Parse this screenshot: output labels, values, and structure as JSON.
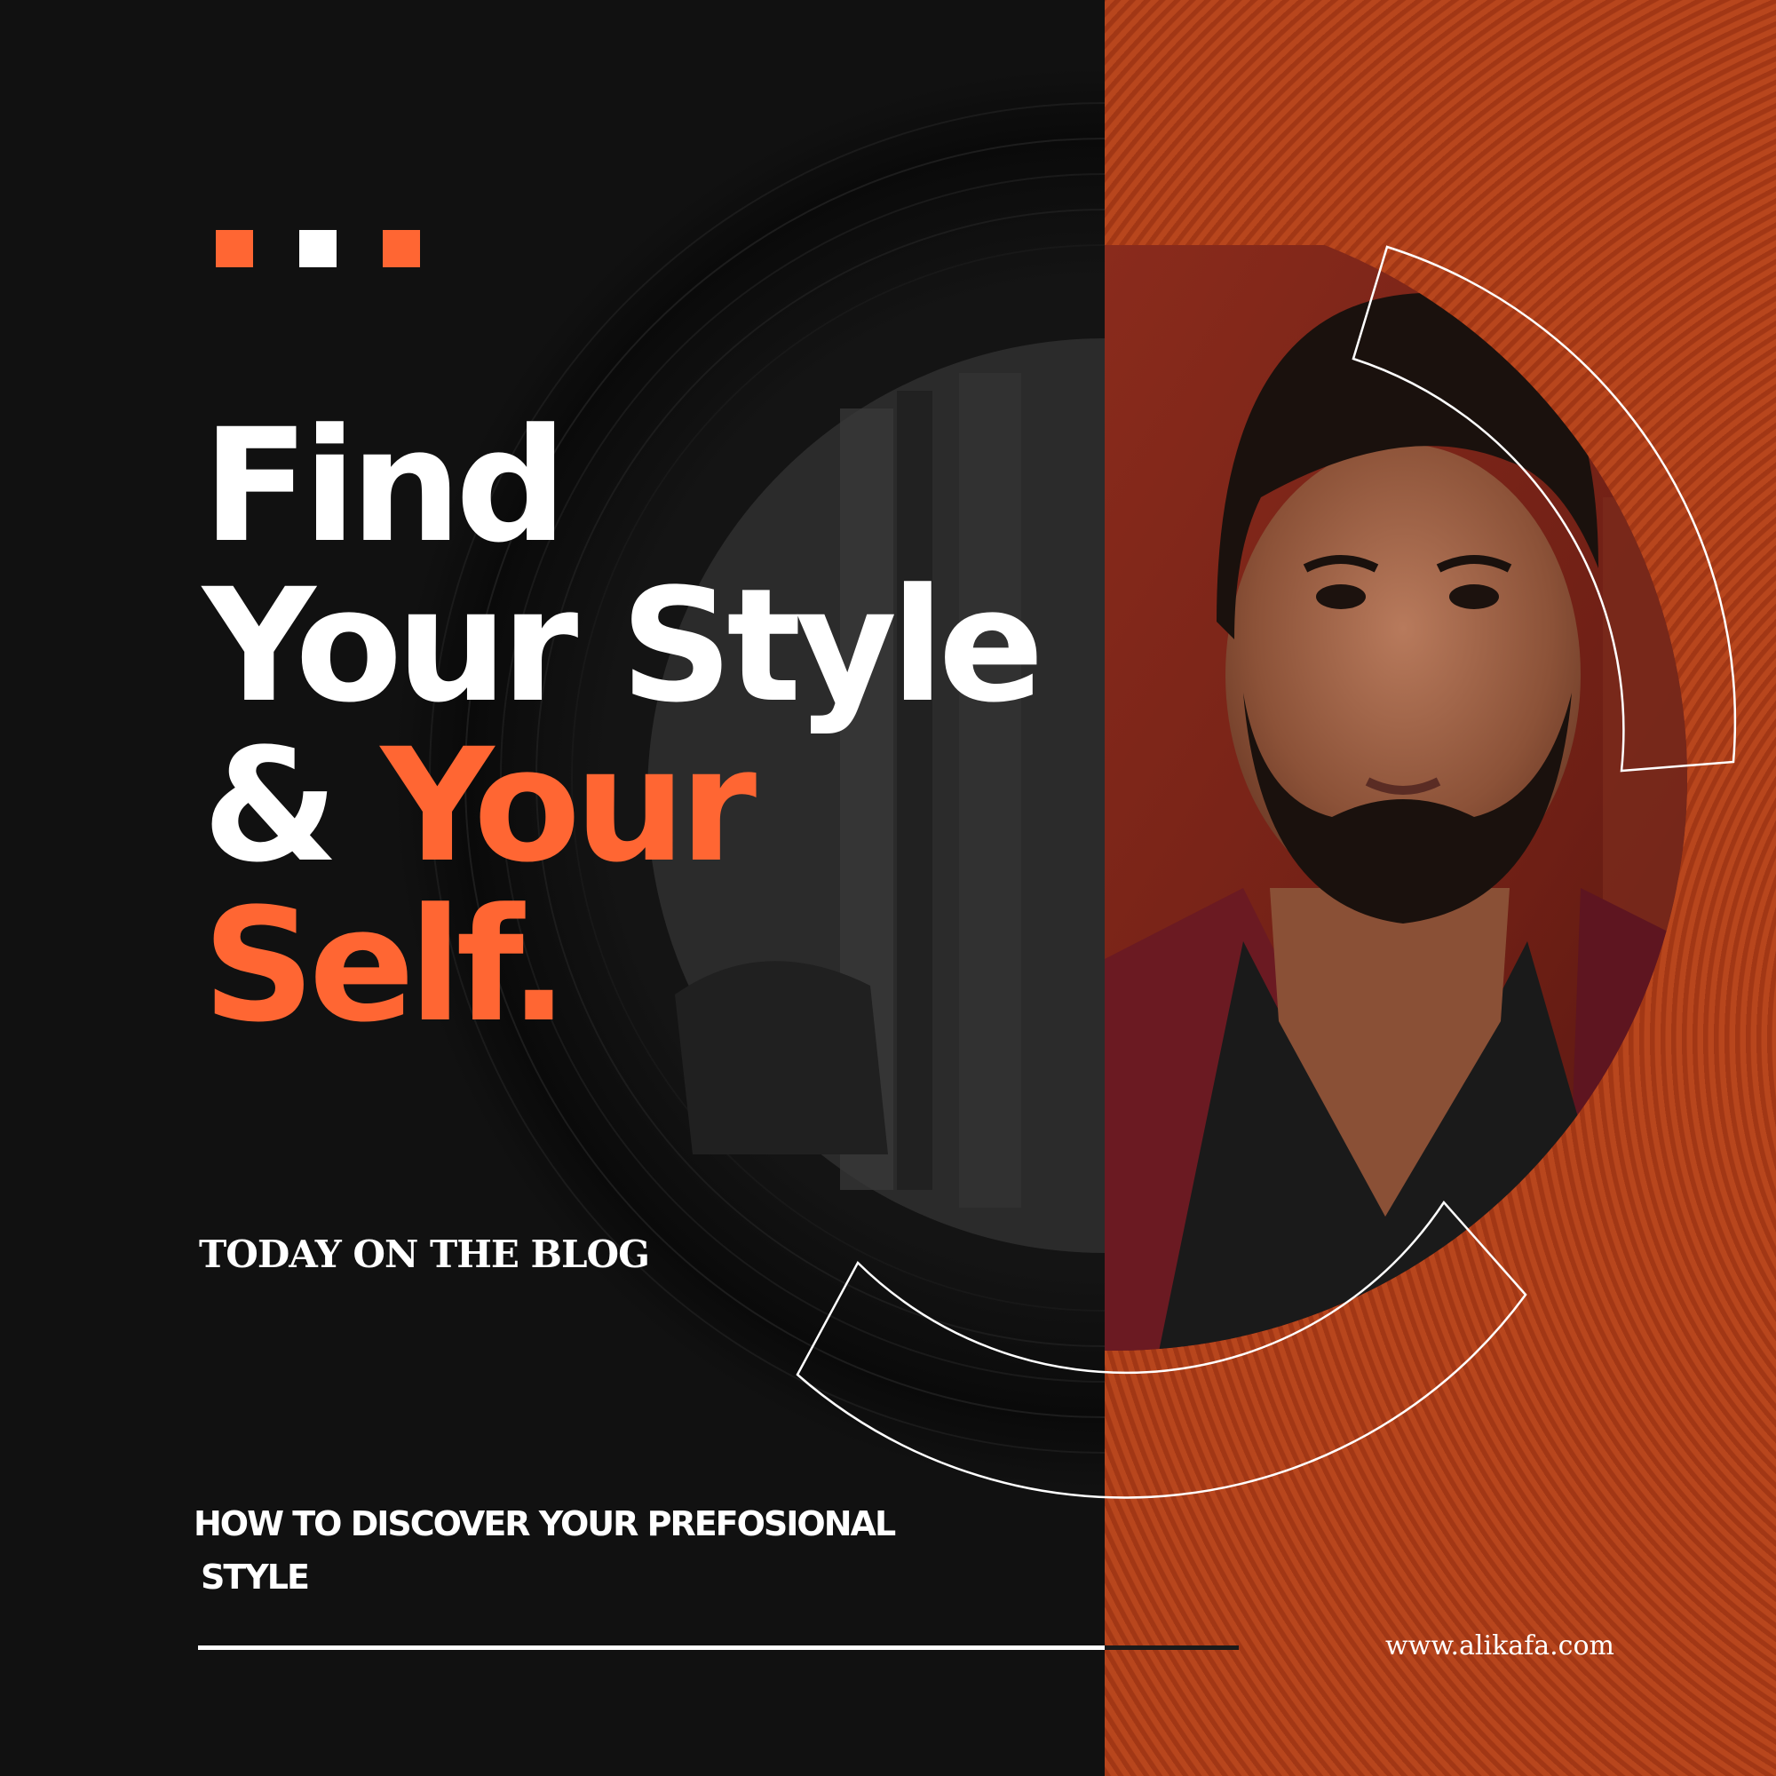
{
  "headline": {
    "line1": "Find",
    "line2": "Your Style",
    "line3_white": "& ",
    "line3_accent": "Your",
    "line4": "Self."
  },
  "kicker": "TODAY ON THE  BLOG",
  "subtitle": {
    "line1": "HOW TO DISCOVER YOUR PREFOSIONAL",
    "line2": "STYLE"
  },
  "website": "www.alikafa.com",
  "colors": {
    "background_dark": "#111111",
    "accent_orange": "#ff6633",
    "rust_panel": "#b1401a",
    "text_white": "#ffffff"
  },
  "decor": {
    "dots": [
      "orange",
      "white",
      "orange"
    ],
    "photo": "portrait-of-bearded-man-in-maroon-jacket"
  }
}
